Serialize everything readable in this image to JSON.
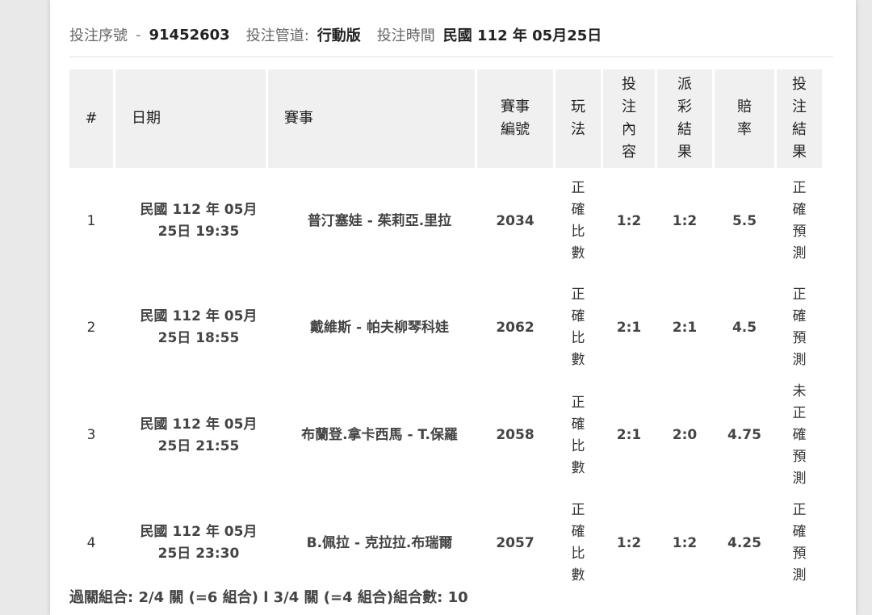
{
  "info": {
    "serial_label": "投注序號",
    "serial_value": "91452603",
    "channel_label": "投注管道:",
    "channel_value": "行動版",
    "time_label": "投注時間",
    "time_value": "民國 112 年 05月25日"
  },
  "table": {
    "headers": {
      "idx": "#",
      "date": "日期",
      "match": "賽事",
      "code": "賽事編號",
      "play": "玩法",
      "bet": "投注內容",
      "result": "派彩結果",
      "odds": "賠率",
      "outcome": "投注結果"
    },
    "rows": [
      {
        "idx": "1",
        "date": "民國 112 年 05月 25日 19:35",
        "match": "普汀塞娃 - 茱莉亞.里拉",
        "code": "2034",
        "play": "正確比數",
        "bet": "1:2",
        "result": "1:2",
        "odds": "5.5",
        "outcome": "正確預測"
      },
      {
        "idx": "2",
        "date": "民國 112 年 05月 25日 18:55",
        "match": "戴維斯 - 帕夫柳琴科娃",
        "code": "2062",
        "play": "正確比數",
        "bet": "2:1",
        "result": "2:1",
        "odds": "4.5",
        "outcome": "正確預測"
      },
      {
        "idx": "3",
        "date": "民國 112 年 05月 25日 21:55",
        "match": "布蘭登.拿卡西馬 - T.保羅",
        "code": "2058",
        "play": "正確比數",
        "bet": "2:1",
        "result": "2:0",
        "odds": "4.75",
        "outcome": "未正確預測"
      },
      {
        "idx": "4",
        "date": "民國 112 年 05月 25日 23:30",
        "match": "B.佩拉 - 克拉拉.布瑞爾",
        "code": "2057",
        "play": "正確比數",
        "bet": "1:2",
        "result": "1:2",
        "odds": "4.25",
        "outcome": "正確預測"
      }
    ]
  },
  "footer": {
    "summary": "過關組合: 2/4 關 (=6 組合) l 3/4 關 (=4 組合)組合數: 10"
  }
}
